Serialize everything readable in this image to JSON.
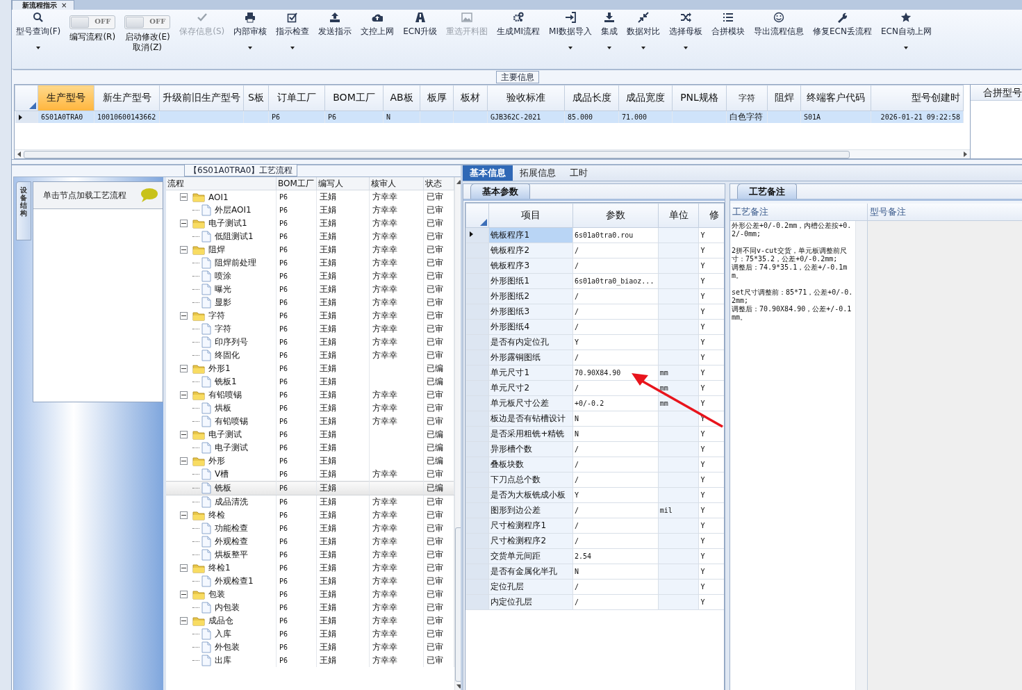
{
  "document_tab": {
    "title": "新流程指示",
    "close": "×"
  },
  "toolbar": [
    {
      "kind": "button",
      "label": "型号查询(F)",
      "dropdown": true,
      "disabled": false
    },
    {
      "kind": "toggle",
      "label": "编写流程(R)",
      "switch_text": "OFF",
      "on": false
    },
    {
      "kind": "toggle",
      "label": "启动修改(E)",
      "label_line2": "取消(Z)",
      "switch_text": "OFF",
      "on": false
    },
    {
      "kind": "button",
      "label": "保存信息(S)",
      "dropdown": false,
      "disabled": true
    },
    {
      "kind": "button",
      "label": "内部审核",
      "dropdown": true,
      "disabled": false
    },
    {
      "kind": "button",
      "label": "指示检查",
      "dropdown": true,
      "disabled": false
    },
    {
      "kind": "button",
      "label": "发送指示",
      "dropdown": false,
      "disabled": false
    },
    {
      "kind": "button",
      "label": "文控上网",
      "dropdown": false,
      "disabled": false
    },
    {
      "kind": "button",
      "label": "ECN升级",
      "dropdown": false,
      "disabled": false
    },
    {
      "kind": "button",
      "label": "重选开料图",
      "dropdown": false,
      "disabled": true
    },
    {
      "kind": "button",
      "label": "生成MI流程",
      "dropdown": false,
      "disabled": false
    },
    {
      "kind": "button",
      "label": "MI数据导入",
      "dropdown": true,
      "disabled": false
    },
    {
      "kind": "button",
      "label": "集成",
      "dropdown": true,
      "disabled": false
    },
    {
      "kind": "button",
      "label": "数据对比",
      "dropdown": true,
      "disabled": false
    },
    {
      "kind": "button",
      "label": "选择母板",
      "dropdown": true,
      "disabled": false
    },
    {
      "kind": "button",
      "label": "合拼模块",
      "dropdown": false,
      "disabled": false
    },
    {
      "kind": "button",
      "label": "导出流程信息",
      "dropdown": false,
      "disabled": false
    },
    {
      "kind": "button",
      "label": "修复ECN丢流程",
      "dropdown": false,
      "disabled": false
    },
    {
      "kind": "button",
      "label": "ECN自动上网",
      "dropdown": true,
      "disabled": false
    }
  ],
  "main_info": {
    "title": "主要信息",
    "columns": [
      {
        "label": "生产型号",
        "selected": true
      },
      {
        "label": "新生产型号",
        "selected": false
      },
      {
        "label": "升级前旧生产型号",
        "selected": false
      },
      {
        "label": "S板",
        "selected": false
      },
      {
        "label": "订单工厂",
        "selected": false
      },
      {
        "label": "BOM工厂",
        "selected": false
      },
      {
        "label": "AB板",
        "selected": false
      },
      {
        "label": "板厚",
        "selected": false
      },
      {
        "label": "板材",
        "selected": false
      },
      {
        "label": "验收标准",
        "selected": false
      },
      {
        "label": "成品长度",
        "selected": false
      },
      {
        "label": "成品宽度",
        "selected": false
      },
      {
        "label": "PNL规格",
        "selected": false
      },
      {
        "label": "字符",
        "selected": false
      },
      {
        "label": "阻焊",
        "selected": false
      },
      {
        "label": "终端客户代码",
        "selected": false
      },
      {
        "label": "型号创建时",
        "selected": false
      }
    ],
    "rows": [
      {
        "selected": true,
        "cells": [
          "6S01A0TRA0",
          "10010600143662",
          null,
          null,
          "P6",
          "P6",
          "N",
          null,
          null,
          "GJB362C-2021",
          "85.000",
          "71.000",
          null,
          "白色字符",
          null,
          "S01A",
          "2026-01-21 09:22:58"
        ]
      }
    ],
    "side_column": "合拼型号"
  },
  "left_panel": {
    "vertical_tab": "设备结构",
    "hint": "单击节点加载工艺流程"
  },
  "process_flow": {
    "title": "【6S01A0TRA0】工艺流程",
    "columns": [
      "流程",
      "BOM工厂",
      "编写人",
      "核审人",
      "状态"
    ],
    "tree": [
      {
        "label": "AOI1",
        "bom": "P6",
        "writer": "王娟",
        "reviewer": "方幸幸",
        "status": "已审",
        "expanded": true,
        "selected": false,
        "children": [
          {
            "label": "外层AOI1",
            "bom": "P6",
            "writer": "王娟",
            "reviewer": "方幸幸",
            "status": "已审",
            "selected": false
          }
        ]
      },
      {
        "label": "电子测试1",
        "bom": "P6",
        "writer": "王娟",
        "reviewer": "方幸幸",
        "status": "已审",
        "expanded": true,
        "selected": false,
        "children": [
          {
            "label": "低阻测试1",
            "bom": "P6",
            "writer": "王娟",
            "reviewer": "方幸幸",
            "status": "已审",
            "selected": false
          }
        ]
      },
      {
        "label": "阻焊",
        "bom": "P6",
        "writer": "王娟",
        "reviewer": "方幸幸",
        "status": "已审",
        "expanded": true,
        "selected": false,
        "children": [
          {
            "label": "阻焊前处理",
            "bom": "P6",
            "writer": "王娟",
            "reviewer": "方幸幸",
            "status": "已审",
            "selected": false
          },
          {
            "label": "喷涂",
            "bom": "P6",
            "writer": "王娟",
            "reviewer": "方幸幸",
            "status": "已审",
            "selected": false
          },
          {
            "label": "曝光",
            "bom": "P6",
            "writer": "王娟",
            "reviewer": "方幸幸",
            "status": "已审",
            "selected": false
          },
          {
            "label": "显影",
            "bom": "P6",
            "writer": "王娟",
            "reviewer": "方幸幸",
            "status": "已审",
            "selected": false
          }
        ]
      },
      {
        "label": "字符",
        "bom": "P6",
        "writer": "王娟",
        "reviewer": "方幸幸",
        "status": "已审",
        "expanded": true,
        "selected": false,
        "children": [
          {
            "label": "字符",
            "bom": "P6",
            "writer": "王娟",
            "reviewer": "方幸幸",
            "status": "已审",
            "selected": false
          },
          {
            "label": "印序列号",
            "bom": "P6",
            "writer": "王娟",
            "reviewer": "方幸幸",
            "status": "已审",
            "selected": false
          },
          {
            "label": "终固化",
            "bom": "P6",
            "writer": "王娟",
            "reviewer": "方幸幸",
            "status": "已审",
            "selected": false
          }
        ]
      },
      {
        "label": "外形1",
        "bom": "P6",
        "writer": "王娟",
        "status": "已编",
        "expanded": true,
        "selected": false,
        "children": [
          {
            "label": "铣板1",
            "bom": "P6",
            "writer": "王娟",
            "status": "已编",
            "selected": false
          }
        ]
      },
      {
        "label": "有铅喷锡",
        "bom": "P6",
        "writer": "王娟",
        "reviewer": "方幸幸",
        "status": "已审",
        "expanded": true,
        "selected": false,
        "children": [
          {
            "label": "烘板",
            "bom": "P6",
            "writer": "王娟",
            "reviewer": "方幸幸",
            "status": "已审",
            "selected": false
          },
          {
            "label": "有铅喷锡",
            "bom": "P6",
            "writer": "王娟",
            "reviewer": "方幸幸",
            "status": "已审",
            "selected": false
          }
        ]
      },
      {
        "label": "电子测试",
        "bom": "P6",
        "writer": "王娟",
        "status": "已编",
        "expanded": true,
        "selected": false,
        "children": [
          {
            "label": "电子测试",
            "bom": "P6",
            "writer": "王娟",
            "status": "已编",
            "selected": false
          }
        ]
      },
      {
        "label": "外形",
        "bom": "P6",
        "writer": "王娟",
        "status": "已编",
        "expanded": true,
        "selected": false,
        "children": [
          {
            "label": "V槽",
            "bom": "P6",
            "writer": "王娟",
            "reviewer": "方幸幸",
            "status": "已审",
            "selected": false
          },
          {
            "label": "铣板",
            "bom": "P6",
            "writer": "王娟",
            "status": "已编",
            "selected": true
          },
          {
            "label": "成品清洗",
            "bom": "P6",
            "writer": "王娟",
            "reviewer": "方幸幸",
            "status": "已审",
            "selected": false
          }
        ]
      },
      {
        "label": "终检",
        "bom": "P6",
        "writer": "王娟",
        "reviewer": "方幸幸",
        "status": "已审",
        "expanded": true,
        "selected": false,
        "children": [
          {
            "label": "功能检查",
            "bom": "P6",
            "writer": "王娟",
            "reviewer": "方幸幸",
            "status": "已审",
            "selected": false
          },
          {
            "label": "外观检查",
            "bom": "P6",
            "writer": "王娟",
            "reviewer": "方幸幸",
            "status": "已审",
            "selected": false
          },
          {
            "label": "烘板整平",
            "bom": "P6",
            "writer": "王娟",
            "reviewer": "方幸幸",
            "status": "已审",
            "selected": false
          }
        ]
      },
      {
        "label": "终检1",
        "bom": "P6",
        "writer": "王娟",
        "reviewer": "方幸幸",
        "status": "已审",
        "expanded": true,
        "selected": false,
        "children": [
          {
            "label": "外观检查1",
            "bom": "P6",
            "writer": "王娟",
            "reviewer": "方幸幸",
            "status": "已审",
            "selected": false
          }
        ]
      },
      {
        "label": "包装",
        "bom": "P6",
        "writer": "王娟",
        "reviewer": "方幸幸",
        "status": "已审",
        "expanded": true,
        "selected": false,
        "children": [
          {
            "label": "内包装",
            "bom": "P6",
            "writer": "王娟",
            "reviewer": "方幸幸",
            "status": "已审",
            "selected": false
          }
        ]
      },
      {
        "label": "成品仓",
        "bom": "P6",
        "writer": "王娟",
        "reviewer": "方幸幸",
        "status": "已审",
        "expanded": true,
        "selected": false,
        "children": [
          {
            "label": "入库",
            "bom": "P6",
            "writer": "王娟",
            "reviewer": "方幸幸",
            "status": "已审",
            "selected": false
          },
          {
            "label": "外包装",
            "bom": "P6",
            "writer": "王娟",
            "reviewer": "方幸幸",
            "status": "已审",
            "selected": false
          },
          {
            "label": "出库",
            "bom": "P6",
            "writer": "王娟",
            "reviewer": "方幸幸",
            "status": "已审",
            "selected": false
          }
        ]
      }
    ]
  },
  "detail_tabs": [
    {
      "label": "基本信息",
      "selected": true
    },
    {
      "label": "拓展信息",
      "selected": false
    },
    {
      "label": "工时",
      "selected": false
    }
  ],
  "basic_params": {
    "title": "基本参数",
    "columns": [
      "项目",
      "参数",
      "单位",
      "修"
    ],
    "rows": [
      {
        "item": "铣板程序1",
        "value": "6s01a0tra0.rou",
        "modified": "Y",
        "selected": true
      },
      {
        "item": "铣板程序2",
        "value": "/",
        "modified": "Y",
        "selected": false
      },
      {
        "item": "铣板程序3",
        "value": "/",
        "modified": "Y",
        "selected": false
      },
      {
        "item": "外形图纸1",
        "value": "6s01a0tra0_biaoz...",
        "modified": "Y",
        "selected": false
      },
      {
        "item": "外形图纸2",
        "value": "/",
        "modified": "Y",
        "selected": false
      },
      {
        "item": "外形图纸3",
        "value": "/",
        "modified": "Y",
        "selected": false
      },
      {
        "item": "外形图纸4",
        "value": "/",
        "modified": "Y",
        "selected": false
      },
      {
        "item": "是否有内定位孔",
        "value": "Y",
        "modified": "Y",
        "selected": false
      },
      {
        "item": "外形露铜图纸",
        "value": "/",
        "modified": "Y",
        "selected": false
      },
      {
        "item": "单元尺寸1",
        "value": "70.90X84.90",
        "unit": "mm",
        "modified": "Y",
        "selected": false
      },
      {
        "item": "单元尺寸2",
        "value": "/",
        "unit": "mm",
        "modified": "Y",
        "selected": false
      },
      {
        "item": "单元板尺寸公差",
        "value": "+0/-0.2",
        "unit": "mm",
        "modified": "Y",
        "selected": false
      },
      {
        "item": "板边是否有钻槽设计",
        "value": "N",
        "modified": "Y",
        "selected": false
      },
      {
        "item": "是否采用粗铣+精铣",
        "value": "N",
        "modified": "Y",
        "selected": false
      },
      {
        "item": "异形槽个数",
        "value": "/",
        "modified": "Y",
        "selected": false
      },
      {
        "item": "叠板块数",
        "value": "/",
        "modified": "Y",
        "selected": false
      },
      {
        "item": "下刀点总个数",
        "value": "/",
        "modified": "Y",
        "selected": false
      },
      {
        "item": "是否为大板铣成小板",
        "value": "Y",
        "modified": "Y",
        "selected": false
      },
      {
        "item": "图形到边公差",
        "value": "/",
        "unit": "mil",
        "modified": "Y",
        "selected": false
      },
      {
        "item": "尺寸检测程序1",
        "value": "/",
        "modified": "Y",
        "selected": false
      },
      {
        "item": "尺寸检测程序2",
        "value": "/",
        "modified": "Y",
        "selected": false
      },
      {
        "item": "交货单元间距",
        "value": "2.54",
        "modified": "Y",
        "selected": false
      },
      {
        "item": "是否有金属化半孔",
        "value": "N",
        "modified": "Y",
        "selected": false
      },
      {
        "item": "定位孔层",
        "value": "/",
        "modified": "Y",
        "selected": false
      },
      {
        "item": "内定位孔层",
        "value": "/",
        "modified": "Y",
        "selected": false
      }
    ]
  },
  "process_notes": {
    "title": "工艺备注",
    "columns": [
      "工艺备注",
      "型号备注"
    ],
    "note": "外形公差+0/-0.2mm，内槽公差按+0.2/-0mm;\n\n2拼不同v-cut交货，单元板调整前尺寸：75*35.2，公差+0/-0.2mm;\n调整后：74.9*35.1，公差+/-0.1mm。\n\nset尺寸调整前：85*71，公差+0/-0.2mm;\n调整后：70.90X84.90，公差+/-0.1mm。"
  }
}
